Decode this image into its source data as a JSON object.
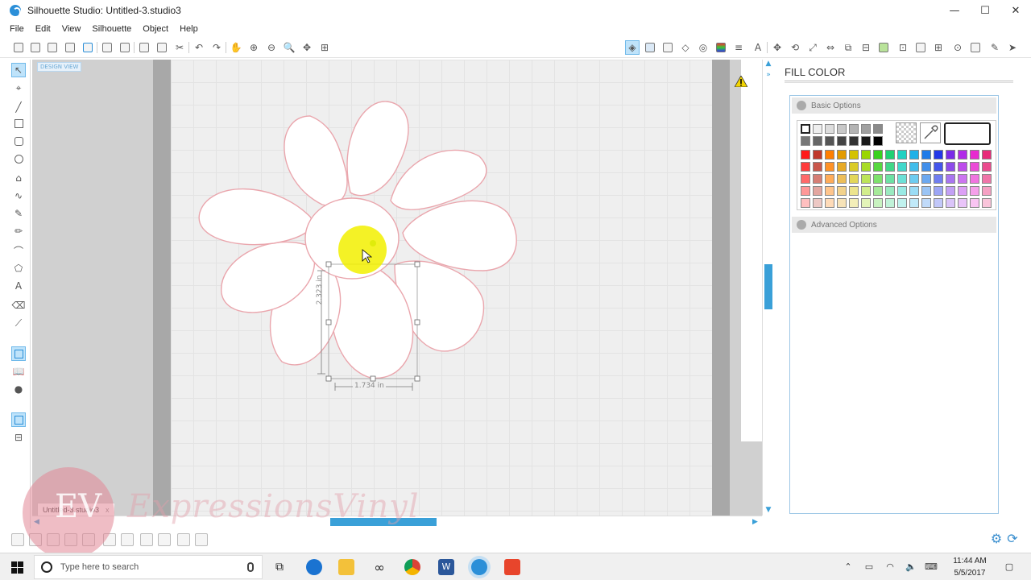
{
  "window": {
    "title": "Silhouette Studio: Untitled-3.studio3",
    "minimize": "—",
    "maximize": "☐",
    "close": "✕"
  },
  "menu": [
    "File",
    "Edit",
    "View",
    "Silhouette",
    "Object",
    "Help"
  ],
  "canvas": {
    "design_view_label": "DESIGN VIEW",
    "dimension_height": "2.323 in",
    "dimension_width": "1.734 in"
  },
  "panel": {
    "title": "FILL COLOR",
    "basic_options": "Basic Options",
    "advanced_options": "Advanced Options",
    "swatch_rows": [
      [
        "#ffffff",
        "#eeeeee",
        "#dddddd",
        "#c8c8c8",
        "#b4b4b4",
        "#a0a0a0",
        "#8a8a8a"
      ],
      [
        "#777777",
        "#666666",
        "#555555",
        "#444444",
        "#333333",
        "#1a1a1a",
        "#000000"
      ]
    ],
    "color_columns": [
      "#ff1a1a",
      "#c0392b",
      "#ff7f00",
      "#e39b00",
      "#d4c200",
      "#9ad600",
      "#39d11f",
      "#1fd173",
      "#1fd1c2",
      "#1fb1e8",
      "#1f7be8",
      "#2338e8",
      "#7a2be8",
      "#b12be8",
      "#e82bd0",
      "#e82b7a"
    ]
  },
  "document_tab": {
    "name": "Untitled-3.studio3",
    "close": "x"
  },
  "watermark": {
    "letters": "EV",
    "text": "ExpressionsVinyl"
  },
  "taskbar": {
    "search_placeholder": "Type here to search",
    "time": "11:44 AM",
    "date": "5/5/2017"
  }
}
